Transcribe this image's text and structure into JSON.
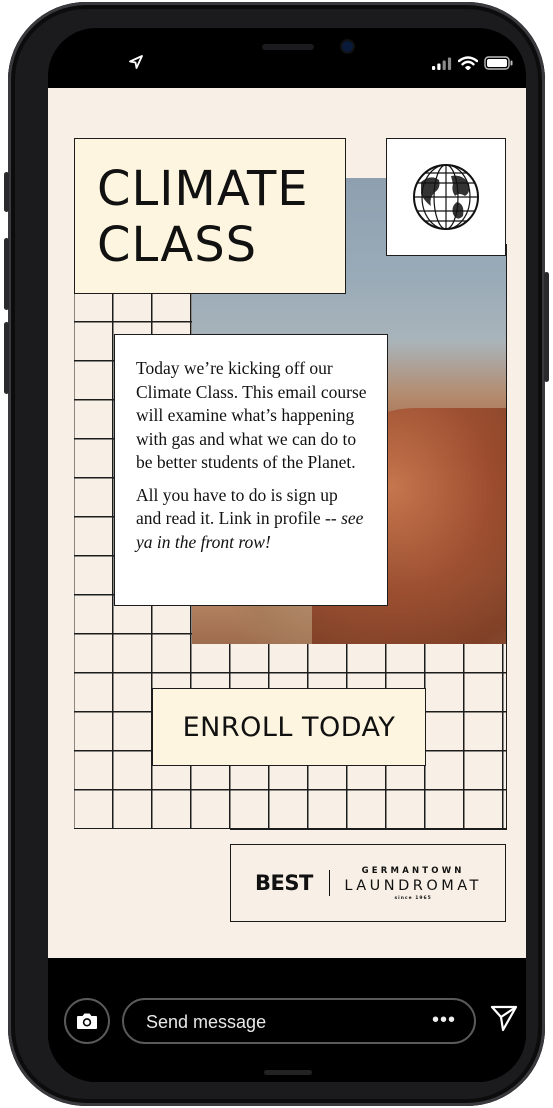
{
  "story": {
    "title": "CLIMATE CLASS",
    "body_paragraph_1": "Today we’re kicking off our Climate Class. This email course will examine what’s happening with gas and what we can do to be better students of the Planet.",
    "body_paragraph_2_plain": "All you have to do is sign up and read it. Link in profile --",
    "body_paragraph_2_italic": "see ya in the front row!",
    "cta": "ENROLL TODAY",
    "brand_best": "BEST",
    "brand_germantown": "GERMANTOWN",
    "brand_laundromat": "LAUNDROMAT",
    "brand_since": "since 1965"
  },
  "message_bar": {
    "placeholder": "Send message",
    "more_label": "•••"
  },
  "icons": {
    "location": "location-arrow-icon",
    "signal": "signal-bars-icon",
    "wifi": "wifi-icon",
    "battery": "battery-icon",
    "globe": "globe-icon",
    "camera": "camera-icon",
    "send": "send-paper-plane-icon"
  },
  "colors": {
    "story_background": "#f8f0e6",
    "title_box": "#fdf5df",
    "ink": "#111111",
    "phone_frame": "#1b1b1d"
  }
}
